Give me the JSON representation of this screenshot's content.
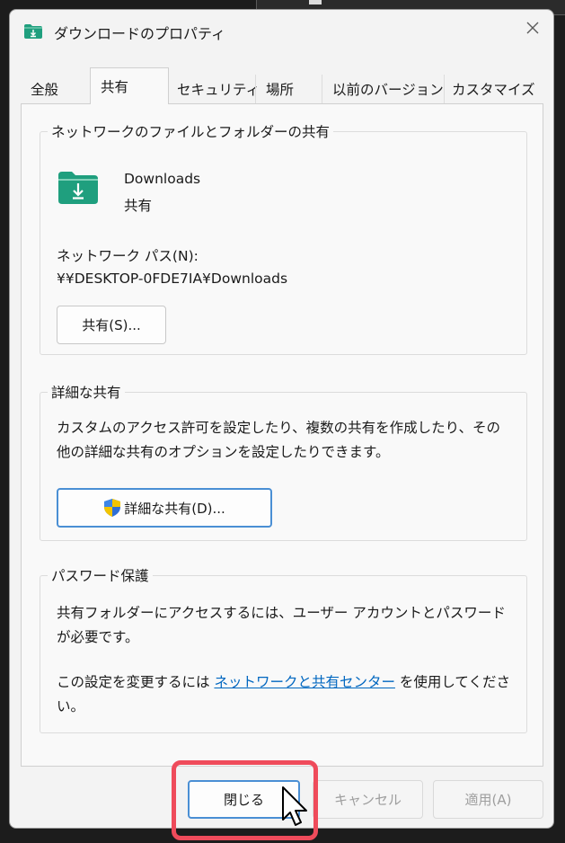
{
  "window": {
    "title": "ダウンロードのプロパティ",
    "folder_icon": "download-folder-icon",
    "close_icon": "close-icon"
  },
  "tabs": [
    {
      "label": "全般",
      "active": false
    },
    {
      "label": "共有",
      "active": true
    },
    {
      "label": "セキュリティ",
      "active": false
    },
    {
      "label": "場所",
      "active": false
    },
    {
      "label": "以前のバージョン",
      "active": false
    },
    {
      "label": "カスタマイズ",
      "active": false
    }
  ],
  "network_sharing": {
    "group_title": "ネットワークのファイルとフォルダーの共有",
    "folder_name": "Downloads",
    "share_status": "共有",
    "network_path_label": "ネットワーク パス(N):",
    "network_path_value": "¥¥DESKTOP-0FDE7IA¥Downloads",
    "share_button": "共有(S)..."
  },
  "advanced_sharing": {
    "group_title": "詳細な共有",
    "description": "カスタムのアクセス許可を設定したり、複数の共有を作成したり、その他の詳細な共有のオプションを設定したりできます。",
    "button": "詳細な共有(D)...",
    "button_icon": "uac-shield-icon"
  },
  "password_protection": {
    "group_title": "パスワード保護",
    "description": "共有フォルダーにアクセスするには、ユーザー アカウントとパスワードが必要です。",
    "settings_prefix": "この設定を変更するには ",
    "settings_link": "ネットワークと共有センター",
    "settings_suffix": " を使用してください。"
  },
  "footer": {
    "close": "閉じる",
    "cancel": "キャンセル",
    "apply": "適用(A)"
  },
  "colors": {
    "accent": "#4a8fd4",
    "link": "#0067c0",
    "highlight": "#ef4b5b",
    "folder": "#1f9f7e"
  }
}
